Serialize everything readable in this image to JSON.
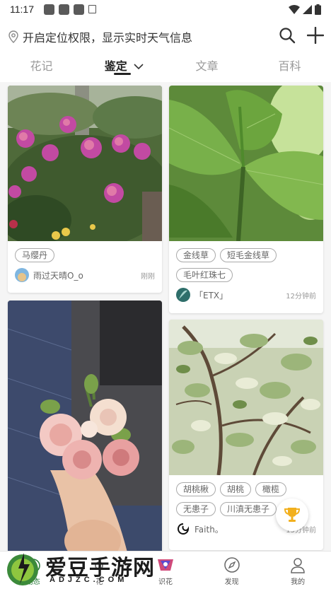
{
  "status_bar": {
    "time": "11:17"
  },
  "header": {
    "location_text": "开启定位权限，显示实时天气信息",
    "tabs": [
      {
        "label": "花记"
      },
      {
        "label": "鉴定",
        "active": true
      },
      {
        "label": "文章"
      },
      {
        "label": "百科"
      }
    ]
  },
  "feed": {
    "cards": [
      {
        "tags": [
          "马缨丹"
        ],
        "user": "雨过天晴O_o",
        "time": "刚刚"
      },
      {
        "tags": [
          "金线草",
          "短毛金线草",
          "毛叶红珠七"
        ],
        "user": "「ETX」",
        "time": "12分钟前"
      },
      {
        "tags": [],
        "user": "",
        "time": ""
      },
      {
        "tags": [
          "胡桃楸",
          "胡桃",
          "橄榄",
          "无患子",
          "川滇无患子"
        ],
        "user": "Faith。",
        "time": "15分钟前"
      }
    ]
  },
  "bottom_nav": {
    "items": [
      {
        "label": "动态",
        "icon": "home-icon"
      },
      {
        "label": "花",
        "icon": "flower-icon"
      },
      {
        "label": "识花",
        "icon": "camera-icon"
      },
      {
        "label": "发现",
        "icon": "compass-icon"
      },
      {
        "label": "我的",
        "icon": "person-icon"
      }
    ]
  },
  "watermark": {
    "text": "爱豆手游网",
    "url": "ADJZC.COM"
  },
  "colors": {
    "accent": "#2a7a3b",
    "tag_border": "#aaaaaa",
    "background": "#f5f5f5"
  }
}
